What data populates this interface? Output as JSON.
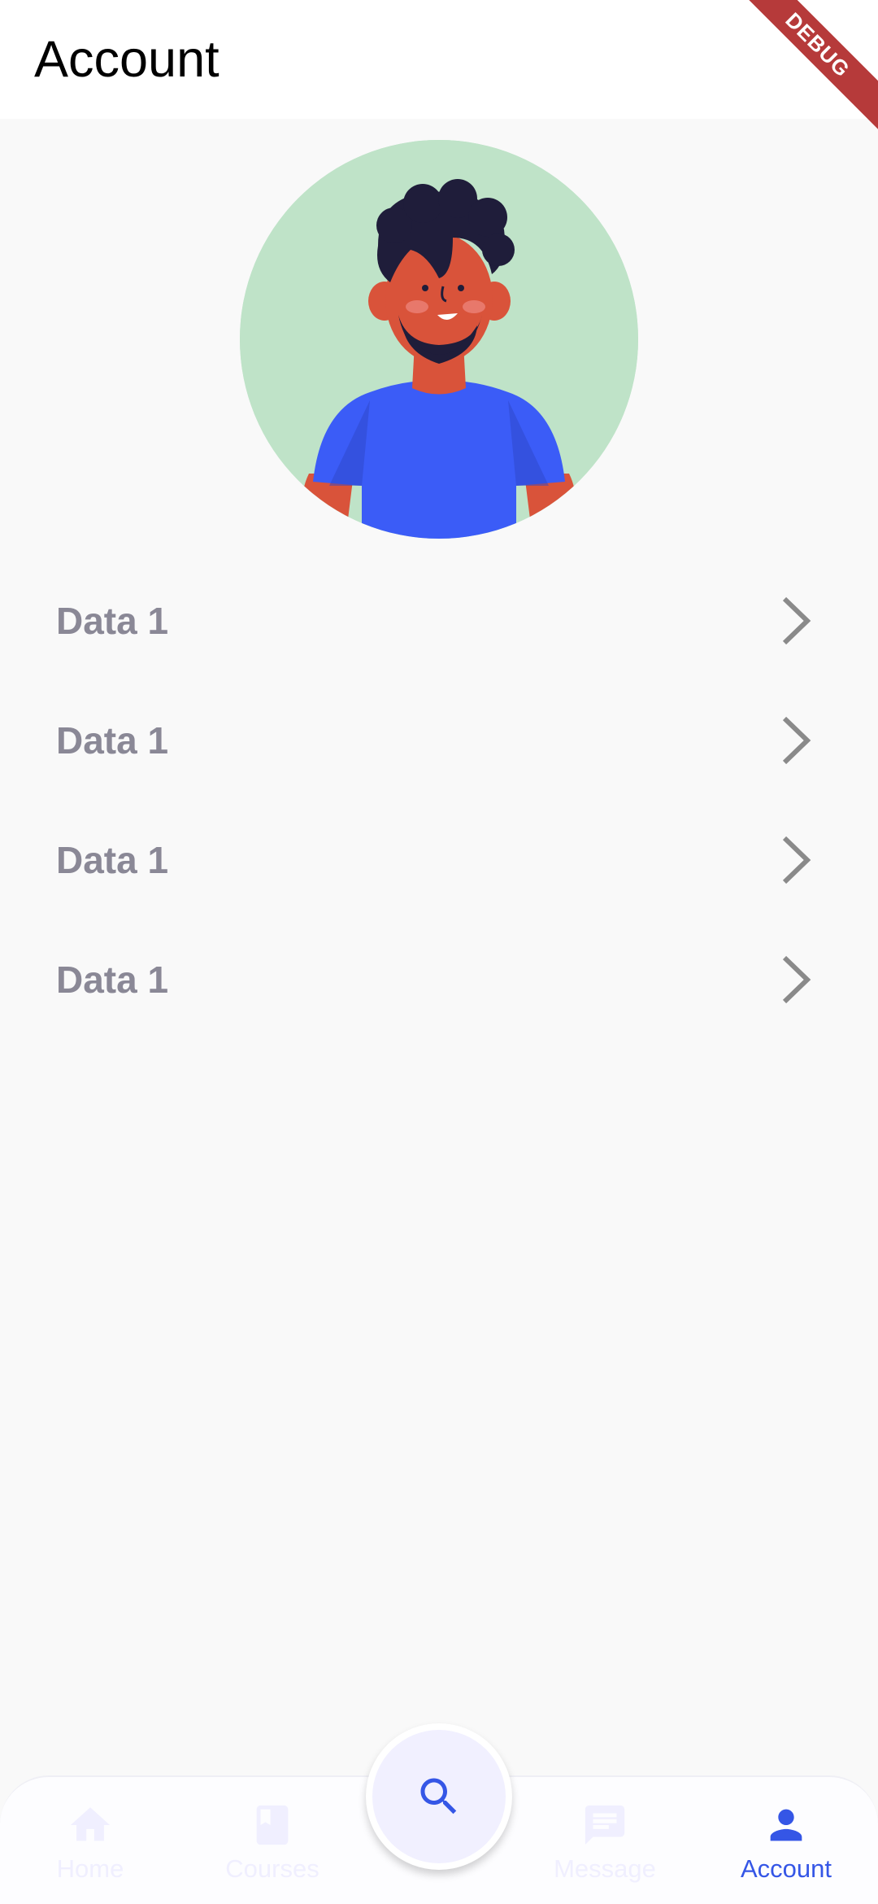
{
  "app_bar": {
    "title": "Account",
    "debug_label": "DEBUG"
  },
  "avatar": {
    "icon": "avatar-man-illustration",
    "background_color": "#bfe3c8"
  },
  "menu": {
    "items": [
      {
        "label": "Data 1",
        "icon": "chevron-right-icon"
      },
      {
        "label": "Data 1",
        "icon": "chevron-right-icon"
      },
      {
        "label": "Data 1",
        "icon": "chevron-right-icon"
      },
      {
        "label": "Data 1",
        "icon": "chevron-right-icon"
      }
    ]
  },
  "fab": {
    "icon": "search-icon"
  },
  "bottom_nav": {
    "active_color": "#3556e6",
    "inactive_color": "#f0efff",
    "items": [
      {
        "label": "Home",
        "icon": "home-icon",
        "active": false
      },
      {
        "label": "Courses",
        "icon": "book-icon",
        "active": false
      },
      {
        "label": "Message",
        "icon": "message-icon",
        "active": false
      },
      {
        "label": "Account",
        "icon": "person-icon",
        "active": true
      }
    ]
  }
}
